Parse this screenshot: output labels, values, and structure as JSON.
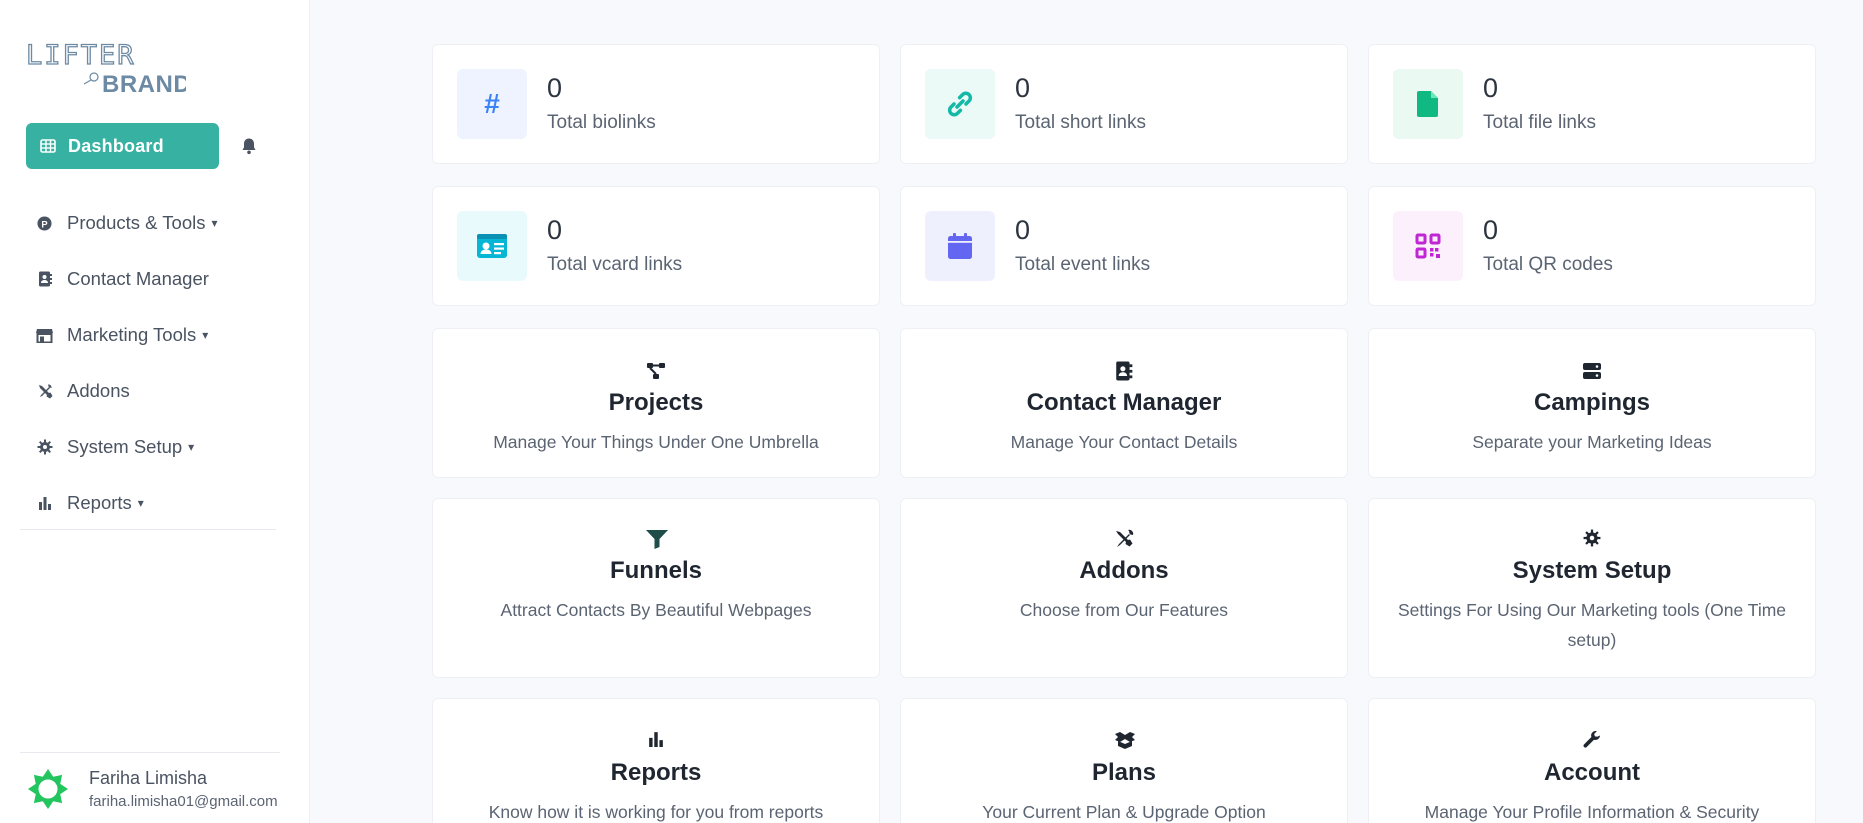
{
  "logo": {
    "line1": "LIFTER",
    "line2": "BRAND"
  },
  "sidebar": {
    "dashboard_label": "Dashboard",
    "items": [
      {
        "label": "Products & Tools",
        "icon": "product-icon",
        "has_caret": true
      },
      {
        "label": "Contact Manager",
        "icon": "address-book-icon",
        "has_caret": false
      },
      {
        "label": "Marketing Tools",
        "icon": "store-icon",
        "has_caret": true
      },
      {
        "label": "Addons",
        "icon": "tools-icon",
        "has_caret": false
      },
      {
        "label": "System Setup",
        "icon": "gear-icon",
        "has_caret": true
      },
      {
        "label": "Reports",
        "icon": "bar-chart-icon",
        "has_caret": true
      }
    ],
    "caret": "▾"
  },
  "user": {
    "name": "Fariha Limisha",
    "email": "fariha.limisha01@gmail.com"
  },
  "stats": [
    {
      "value": "0",
      "label": "Total biolinks",
      "icon": "hash-icon",
      "color": "#3b82f6",
      "bg": "#eef3ff"
    },
    {
      "value": "0",
      "label": "Total short links",
      "icon": "link-icon",
      "color": "#14b8a6",
      "bg": "#ebfaf7"
    },
    {
      "value": "0",
      "label": "Total file links",
      "icon": "file-icon",
      "color": "#10b981",
      "bg": "#eafaf2"
    },
    {
      "value": "0",
      "label": "Total vcard links",
      "icon": "id-card-icon",
      "color": "#06b6d4",
      "bg": "#e9fafd"
    },
    {
      "value": "0",
      "label": "Total event links",
      "icon": "calendar-icon",
      "color": "#6366f1",
      "bg": "#eef0fe"
    },
    {
      "value": "0",
      "label": "Total QR codes",
      "icon": "qr-code-icon",
      "color": "#c026d3",
      "bg": "#fcf0fd"
    }
  ],
  "features": [
    {
      "title": "Projects",
      "desc": "Manage Your Things Under One Umbrella",
      "icon": "project-diagram-icon"
    },
    {
      "title": "Contact Manager",
      "desc": "Manage Your Contact Details",
      "icon": "address-book-icon"
    },
    {
      "title": "Campings",
      "desc": "Separate your Marketing Ideas",
      "icon": "server-icon"
    },
    {
      "title": "Funnels",
      "desc": "Attract Contacts By Beautiful Webpages",
      "icon": "funnel-icon"
    },
    {
      "title": "Addons",
      "desc": "Choose from Our Features",
      "icon": "tools-icon"
    },
    {
      "title": "System Setup",
      "desc": "Settings For Using Our Marketing tools (One Time setup)",
      "icon": "gear-icon"
    },
    {
      "title": "Reports",
      "desc": "Know how it is working for you from reports",
      "icon": "bar-chart-icon"
    },
    {
      "title": "Plans",
      "desc": "Your Current Plan & Upgrade Option",
      "icon": "box-icon"
    },
    {
      "title": "Account",
      "desc": "Manage Your Profile Information & Security",
      "icon": "wrench-icon"
    }
  ]
}
